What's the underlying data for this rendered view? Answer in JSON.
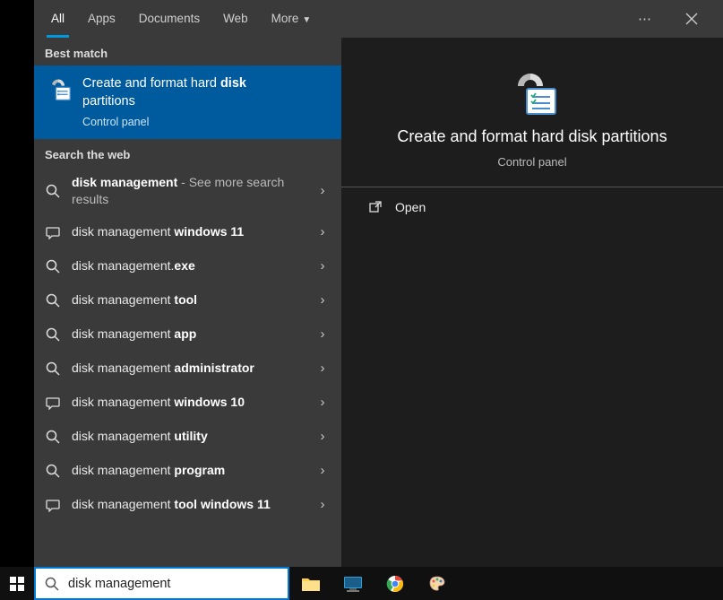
{
  "tabs": {
    "all": "All",
    "apps": "Apps",
    "documents": "Documents",
    "web": "Web",
    "more": "More"
  },
  "sections": {
    "best_match": "Best match",
    "search_web": "Search the web"
  },
  "best_match": {
    "title_pre": "Create and format hard ",
    "title_bold": "disk",
    "title_line2": "partitions",
    "subtitle": "Control panel"
  },
  "web_results": [
    {
      "icon": "search",
      "pre": "",
      "bold": "disk management",
      "post": "",
      "sub": " - See more search results"
    },
    {
      "icon": "chat",
      "pre": "disk management ",
      "bold": "windows 11",
      "post": "",
      "sub": ""
    },
    {
      "icon": "search",
      "pre": "disk management.",
      "bold": "exe",
      "post": "",
      "sub": ""
    },
    {
      "icon": "search",
      "pre": "disk management ",
      "bold": "tool",
      "post": "",
      "sub": ""
    },
    {
      "icon": "search",
      "pre": "disk management ",
      "bold": "app",
      "post": "",
      "sub": ""
    },
    {
      "icon": "search",
      "pre": "disk management ",
      "bold": "administrator",
      "post": "",
      "sub": ""
    },
    {
      "icon": "chat",
      "pre": "disk management ",
      "bold": "windows 10",
      "post": "",
      "sub": ""
    },
    {
      "icon": "search",
      "pre": "disk management ",
      "bold": "utility",
      "post": "",
      "sub": ""
    },
    {
      "icon": "search",
      "pre": "disk management ",
      "bold": "program",
      "post": "",
      "sub": ""
    },
    {
      "icon": "chat",
      "pre": "disk management ",
      "bold": "tool windows 11",
      "post": "",
      "sub": ""
    }
  ],
  "preview": {
    "title": "Create and format hard disk partitions",
    "subtitle": "Control panel",
    "open": "Open"
  },
  "search_input": {
    "value": "disk management"
  }
}
